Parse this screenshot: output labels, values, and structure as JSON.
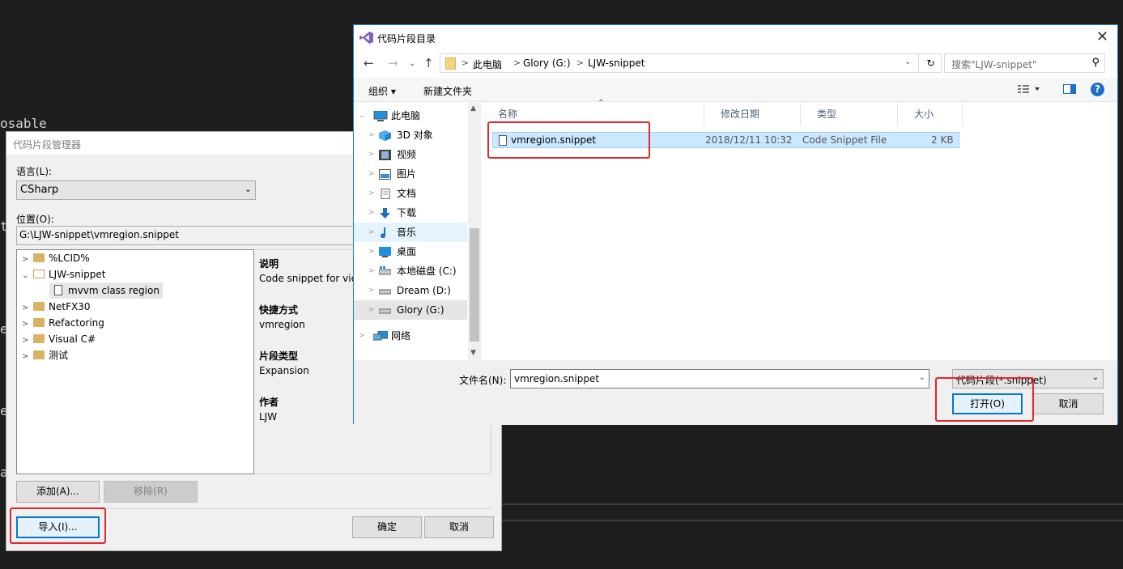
{
  "editor": {
    "fragments": [
      "osable",
      "t",
      "e",
      "e",
      "a"
    ]
  },
  "manager": {
    "title": "代码片段管理器",
    "language_label": "语言(L):",
    "language_value": "CSharp",
    "location_label": "位置(O):",
    "location_value": "G:\\LJW-snippet\\vmregion.snippet",
    "tree": [
      {
        "label": "%LCID%",
        "expanded": false
      },
      {
        "label": "LJW-snippet",
        "expanded": true
      },
      {
        "label": "mvvm class region",
        "selected": true
      },
      {
        "label": "NetFX30",
        "expanded": false
      },
      {
        "label": "Refactoring",
        "expanded": false
      },
      {
        "label": "Visual C#",
        "expanded": false
      },
      {
        "label": "测试",
        "expanded": false
      }
    ],
    "details": {
      "description_label": "说明",
      "description_value": "Code snippet for vie",
      "shortcut_label": "快捷方式",
      "shortcut_value": "vmregion",
      "type_label": "片段类型",
      "type_value": "Expansion",
      "author_label": "作者",
      "author_value": "LJW"
    },
    "buttons": {
      "add": "添加(A)...",
      "remove": "移除(R)",
      "import": "导入(I)...",
      "ok": "确定",
      "cancel": "取消"
    }
  },
  "file_dialog": {
    "title": "代码片段目录",
    "breadcrumb": [
      "此电脑",
      "Glory (G:)",
      "LJW-snippet"
    ],
    "search_placeholder": "搜索\"LJW-snippet\"",
    "toolbar": {
      "organize": "组织 ▾",
      "new_folder": "新建文件夹"
    },
    "nav_items": [
      {
        "label": "此电脑",
        "icon": "pc-icon"
      },
      {
        "label": "3D 对象",
        "icon": "3d-objects-icon"
      },
      {
        "label": "视频",
        "icon": "video-icon"
      },
      {
        "label": "图片",
        "icon": "pictures-icon"
      },
      {
        "label": "文档",
        "icon": "documents-icon"
      },
      {
        "label": "下载",
        "icon": "download-icon"
      },
      {
        "label": "音乐",
        "icon": "music-icon"
      },
      {
        "label": "桌面",
        "icon": "desktop-icon"
      },
      {
        "label": "本地磁盘 (C:)",
        "icon": "drive-icon"
      },
      {
        "label": "Dream (D:)",
        "icon": "drive-icon"
      },
      {
        "label": "Glory (G:)",
        "icon": "drive-icon"
      },
      {
        "label": "网络",
        "icon": "network-icon"
      }
    ],
    "columns": [
      "名称",
      "修改日期",
      "类型",
      "大小"
    ],
    "files": [
      {
        "name": "vmregion.snippet",
        "modified": "2018/12/11 10:32",
        "type": "Code Snippet File",
        "size": "2 KB"
      }
    ],
    "filename_label": "文件名(N):",
    "filename_value": "vmregion.snippet",
    "filter_value": "代码片段(*.snippet)",
    "open_button": "打开(O)",
    "cancel_button": "取消"
  },
  "colors": {
    "highlight_box": "#e5262b",
    "selection": "#cce8ff",
    "accent": "#0078d7"
  }
}
